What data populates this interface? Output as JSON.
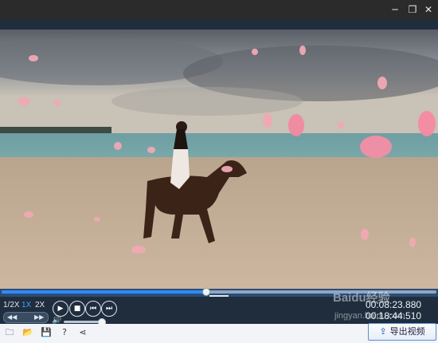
{
  "window": {
    "minimize_icon": "minimize-icon",
    "restore_icon": "restore-icon",
    "close_icon": "close-icon"
  },
  "playback": {
    "progress_fraction": 0.47,
    "current_time": "00:08:23.880",
    "total_time": "00:18:44.510",
    "speeds": [
      "1/2X",
      "1X",
      "2X"
    ],
    "active_speed": "1X",
    "volume_fraction": 0.95,
    "collapse_symbol": "⌄"
  },
  "buttons": {
    "play_icon": "play-icon",
    "stop_icon": "stop-icon",
    "prev_icon": "previous-icon",
    "next_icon": "next-icon",
    "step_back": "◀◀",
    "step_forward": "▶▶"
  },
  "toolbar": {
    "icons": [
      "folder-add-icon",
      "open-folder-icon",
      "save-icon",
      "help-icon",
      "share-icon"
    ],
    "export_label": "导出视频"
  },
  "watermark": {
    "text": "Baidu经验",
    "sub": "jingyan.baidu.com"
  }
}
